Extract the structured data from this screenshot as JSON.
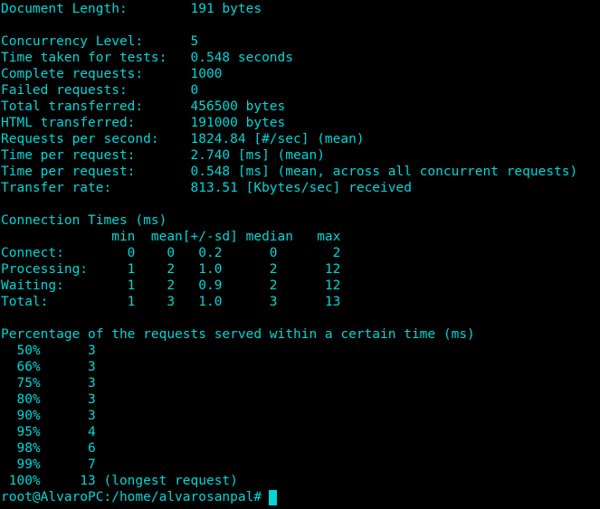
{
  "terminal": {
    "text_color": "#00d7d7",
    "background_color": "#000000",
    "summary": {
      "document_length": "Document Length:        191 bytes",
      "concurrency": "Concurrency Level:      5",
      "time_taken": "Time taken for tests:   0.548 seconds",
      "complete_requests": "Complete requests:      1000",
      "failed_requests": "Failed requests:        0",
      "total_transferred": "Total transferred:      456500 bytes",
      "html_transferred": "HTML transferred:       191000 bytes",
      "requests_per_second": "Requests per second:    1824.84 [#/sec] (mean)",
      "time_per_request_mean": "Time per request:       2.740 [ms] (mean)",
      "time_per_request_concurrent": "Time per request:       0.548 [ms] (mean, across all concurrent requests)",
      "transfer_rate": "Transfer rate:          813.51 [Kbytes/sec] received"
    },
    "connection_times": {
      "title": "Connection Times (ms)",
      "header": "              min  mean[+/-sd] median   max",
      "rows": [
        "Connect:        0    0   0.2      0       2",
        "Processing:     1    2   1.0      2      12",
        "Waiting:        1    2   0.9      2      12",
        "Total:          1    3   1.0      3      13"
      ]
    },
    "percentiles": {
      "title": "Percentage of the requests served within a certain time (ms)",
      "rows": [
        "  50%      3",
        "  66%      3",
        "  75%      3",
        "  80%      3",
        "  90%      3",
        "  95%      4",
        "  98%      6",
        "  99%      7",
        " 100%     13 (longest request)"
      ]
    },
    "prompt": "root@AlvaroPC:/home/alvarosanpal#"
  }
}
